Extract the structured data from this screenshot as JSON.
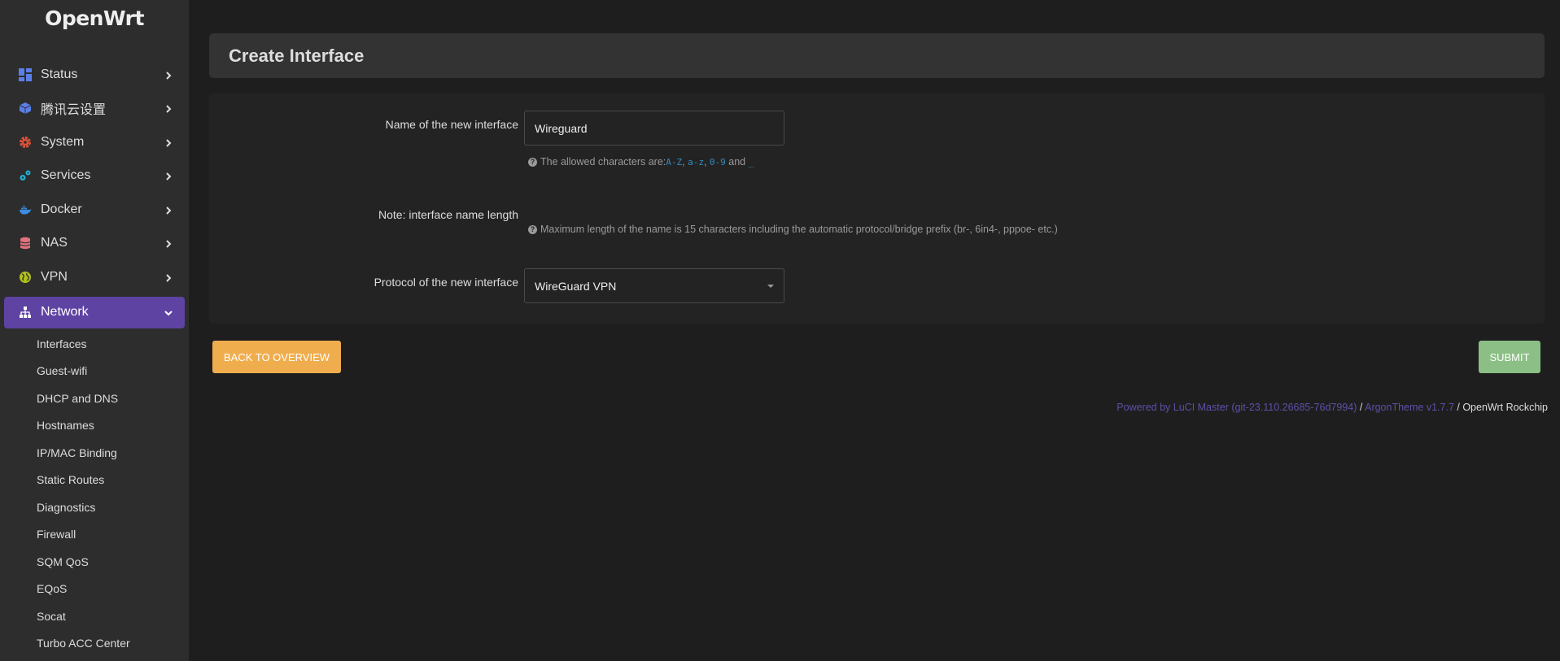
{
  "brand": "OpenWrt",
  "sidebar": {
    "items": [
      {
        "label": "Status",
        "icon": "dashboard-icon",
        "color": "#5b7fe8"
      },
      {
        "label": "腾讯云设置",
        "icon": "cube-icon",
        "color": "#5b7fe8"
      },
      {
        "label": "System",
        "icon": "gear-icon",
        "color": "#e0533a"
      },
      {
        "label": "Services",
        "icon": "cogs-icon",
        "color": "#1fb0d6"
      },
      {
        "label": "Docker",
        "icon": "docker-icon",
        "color": "#3a8de0"
      },
      {
        "label": "NAS",
        "icon": "database-icon",
        "color": "#e0727f"
      },
      {
        "label": "VPN",
        "icon": "globe-icon",
        "color": "#b2c21a"
      },
      {
        "label": "Network",
        "icon": "sitemap-icon",
        "color": "#ffffff"
      }
    ],
    "submenu": [
      "Interfaces",
      "Guest-wifi",
      "DHCP and DNS",
      "Hostnames",
      "IP/MAC Binding",
      "Static Routes",
      "Diagnostics",
      "Firewall",
      "SQM QoS",
      "EQoS",
      "Socat",
      "Turbo ACC Center"
    ]
  },
  "header": {
    "title": "Create Interface"
  },
  "form": {
    "name_label": "Name of the new interface",
    "name_value": "Wireguard",
    "name_hint_prefix": "The allowed characters are: ",
    "hint_az_upper": "A-Z",
    "hint_az_lower": "a-z",
    "hint_digits": "0-9",
    "hint_and": " and ",
    "hint_underscore": "_",
    "note_label": "Note: interface name length",
    "note_hint": "Maximum length of the name is 15 characters including the automatic protocol/bridge prefix (br-, 6in4-, pppoe- etc.)",
    "protocol_label": "Protocol of the new interface",
    "protocol_value": "WireGuard VPN"
  },
  "buttons": {
    "back": "BACK TO OVERVIEW",
    "submit": "SUBMIT"
  },
  "footer": {
    "luci_link": "Powered by LuCI Master (git-23.110.26685-76d7994)",
    "sep1": " / ",
    "theme_link": "ArgonTheme v1.7.7",
    "sep2": " / ",
    "device": "OpenWrt Rockchip"
  }
}
